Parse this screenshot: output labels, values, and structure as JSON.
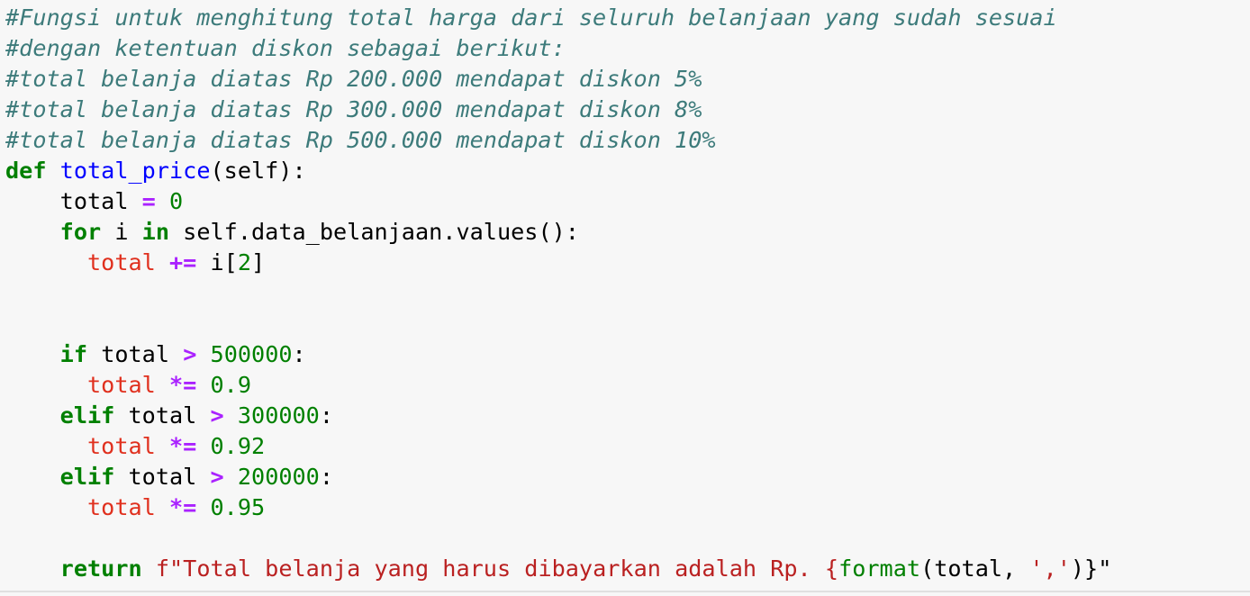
{
  "code": {
    "comments": [
      "#Fungsi untuk menghitung total harga dari seluruh belanjaan yang sudah sesuai",
      "#dengan ketentuan diskon sebagai berikut:",
      "#total belanja diatas Rp 200.000 mendapat diskon 5%",
      "#total belanja diatas Rp 300.000 mendapat diskon 8%",
      "#total belanja diatas Rp 500.000 mendapat diskon 10%"
    ],
    "kw_def": "def",
    "func_name": "total_price",
    "func_sig": "(self):",
    "total": "total",
    "eq": "=",
    "zero": "0",
    "kw_for": "for",
    "loop_var": " i ",
    "kw_in": "in",
    "iter_expr": " self.data_belanjaan.values():",
    "plus_eq": "+=",
    "index_expr": " i[",
    "index_num": "2",
    "index_close": "]",
    "kw_if": "if",
    "kw_elif": "elif",
    "gt": ">",
    "times_eq": "*=",
    "colon": ":",
    "thresholds": [
      "500000",
      "300000",
      "200000"
    ],
    "multipliers": [
      "0.9",
      "0.92",
      "0.95"
    ],
    "kw_return": "return",
    "fstring_text": "f\"Total belanja yang harus dibayarkan adalah Rp. {",
    "format_fn": "format",
    "format_args": "(total, ",
    "comma_str": "','",
    "fstring_end": ")}\""
  }
}
